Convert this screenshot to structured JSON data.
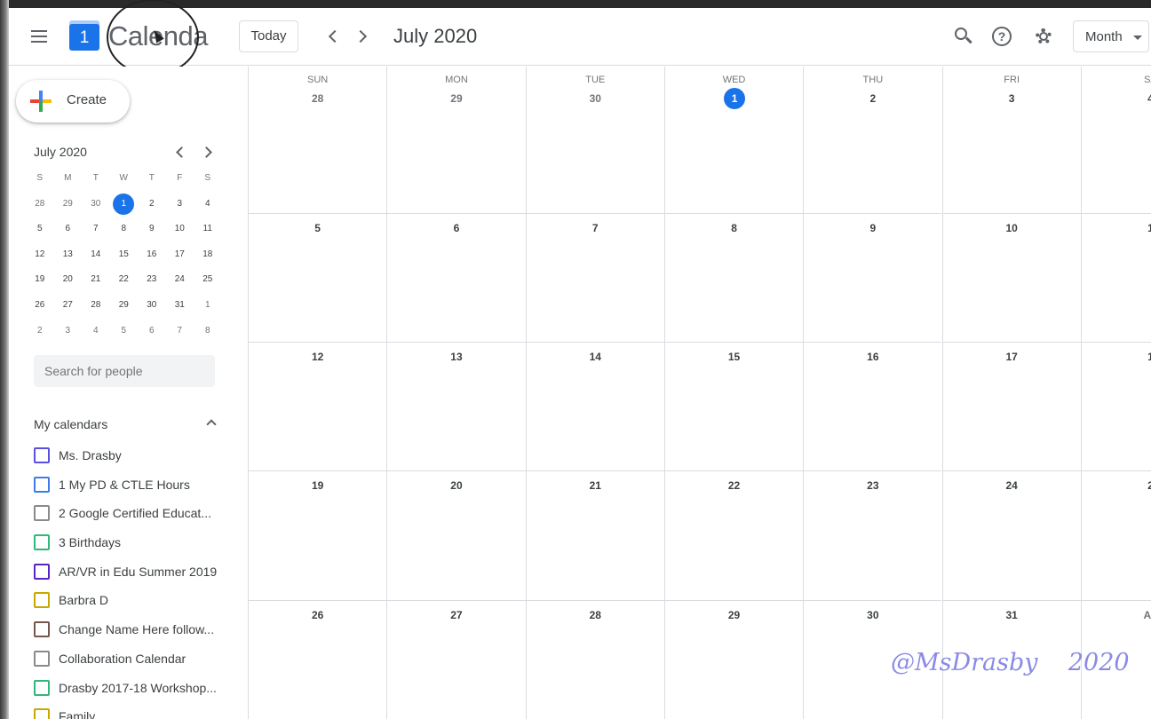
{
  "app": {
    "name": "Calenda",
    "logo_day": "1"
  },
  "header": {
    "today_label": "Today",
    "title": "July 2020",
    "view_selected": "Month"
  },
  "sidebar": {
    "create_label": "Create",
    "mini": {
      "title": "July 2020",
      "weekday_heads": [
        "S",
        "M",
        "T",
        "W",
        "T",
        "F",
        "S"
      ],
      "weeks": [
        [
          "28",
          "29",
          "30",
          "1",
          "2",
          "3",
          "4"
        ],
        [
          "5",
          "6",
          "7",
          "8",
          "9",
          "10",
          "11"
        ],
        [
          "12",
          "13",
          "14",
          "15",
          "16",
          "17",
          "18"
        ],
        [
          "19",
          "20",
          "21",
          "22",
          "23",
          "24",
          "25"
        ],
        [
          "26",
          "27",
          "28",
          "29",
          "30",
          "31",
          "1"
        ],
        [
          "2",
          "3",
          "4",
          "5",
          "6",
          "7",
          "8"
        ]
      ]
    },
    "people_search_placeholder": "Search for people",
    "my_calendars_title": "My calendars",
    "calendars": [
      {
        "name": "Ms. Drasby",
        "color": "#5b4fe0"
      },
      {
        "name": "1 My PD & CTLE Hours",
        "color": "#3f7be8"
      },
      {
        "name": "2 Google Certified Educat...",
        "color": "#8a8a8a"
      },
      {
        "name": "3 Birthdays",
        "color": "#33b679"
      },
      {
        "name": "AR/VR in Edu Summer 2019",
        "color": "#5a23c8"
      },
      {
        "name": "Barbra D",
        "color": "#c9a700"
      },
      {
        "name": "Change Name Here follow...",
        "color": "#795548"
      },
      {
        "name": "Collaboration Calendar",
        "color": "#8a8a8a"
      },
      {
        "name": "Drasby 2017-18 Workshop...",
        "color": "#33b679"
      },
      {
        "name": "Family",
        "color": "#c9a700"
      }
    ]
  },
  "month": {
    "weekday_heads": [
      "SUN",
      "MON",
      "TUE",
      "WED",
      "THU",
      "FRI",
      "SA"
    ],
    "weeks": [
      [
        "28",
        "29",
        "30",
        "1",
        "2",
        "3",
        "4"
      ],
      [
        "5",
        "6",
        "7",
        "8",
        "9",
        "10",
        "1"
      ],
      [
        "12",
        "13",
        "14",
        "15",
        "16",
        "17",
        "1"
      ],
      [
        "19",
        "20",
        "21",
        "22",
        "23",
        "24",
        "2"
      ],
      [
        "26",
        "27",
        "28",
        "29",
        "30",
        "31",
        "Au"
      ]
    ]
  },
  "watermark": "@MsDrasby    2020",
  "colors": {
    "accent": "#1a73e8",
    "border": "#dadce0"
  }
}
